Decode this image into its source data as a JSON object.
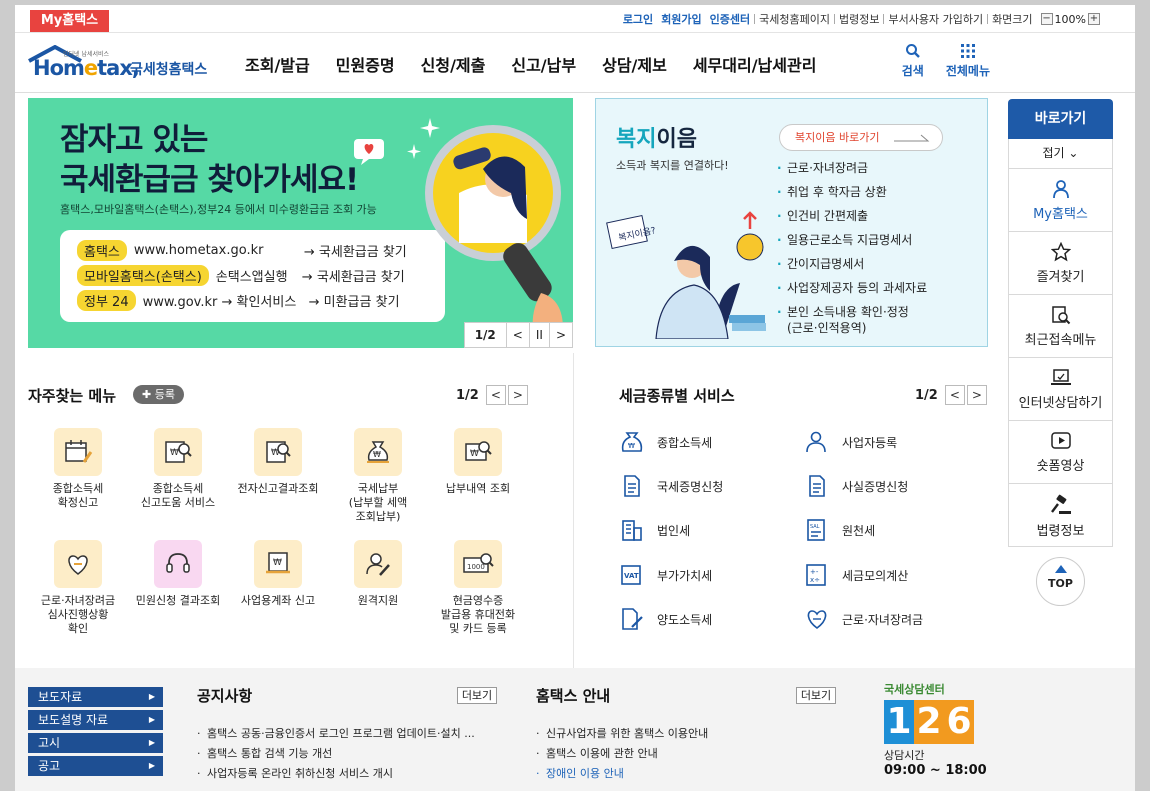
{
  "util": {
    "my_hometax": "My홈택스",
    "login": "로그인",
    "join": "회원가입",
    "cert_center": "인증센터",
    "links": [
      "국세청홈페이지",
      "법령정보",
      "부서사용자 가입하기",
      "화면크기"
    ],
    "zoom_minus": "−",
    "zoom_level": "100%",
    "zoom_plus": "+"
  },
  "logo": {
    "sub": "인터넷 납세서비스",
    "main_a": "Hom",
    "main_e": "e",
    "main_b": "tax,",
    "nts": "국세청홈택스"
  },
  "gnb": [
    "조회/발급",
    "민원증명",
    "신청/제출",
    "신고/납부",
    "상담/제보",
    "세무대리/납세관리"
  ],
  "header_icons": {
    "search": "검색",
    "all_menu": "전체메뉴"
  },
  "banner": {
    "title_line1": "잠자고 있는",
    "title_line2": "국세환급금 찾아가세요!",
    "desc": "홈택스,모바일홈택스(손택스),정부24 등에서 미수령환급금 조회 가능",
    "rows": [
      {
        "pill": "홈택스",
        "site": "www.hometax.go.kr",
        "action": "→ 국세환급금 찾기"
      },
      {
        "pill": "모바일홈택스(손택스)",
        "site": "손택스앱실행",
        "action": "→ 국세환급금 찾기"
      },
      {
        "pill": "정부 24",
        "site": "www.gov.kr → 확인서비스",
        "action": "→ 미환급금 찾기"
      }
    ],
    "page": "1/2",
    "prev": "<",
    "pause": "II",
    "next": ">"
  },
  "welfare": {
    "title_a": "복지",
    "title_b": "이음",
    "subtitle": "소득과 복지를 연결하다!",
    "link": "복지이음 바로가기",
    "sign": "복지이음?",
    "items": [
      "근로·자녀장려금",
      "취업 후 학자금 상환",
      "인건비 간편제출",
      "일용근로소득 지급명세서",
      "간이지급명세서",
      "사업장제공자 등의 과세자료",
      "본인 소득내용 확인·정정 (근로·인적용역)"
    ]
  },
  "quick": {
    "title": "바로가기",
    "fold": "접기 ⌄",
    "items": [
      "My홈택스",
      "즐겨찾기",
      "최근접속메뉴",
      "인터넷상담하기",
      "숏폼영상",
      "법령정보"
    ],
    "top": "TOP"
  },
  "favorites": {
    "title": "자주찾는 메뉴",
    "register": "✚ 등록",
    "page": "1/2",
    "items": [
      "종합소득세\n확정신고",
      "종합소득세\n신고도움 서비스",
      "전자신고결과조회",
      "국세납부\n(납부할 세액\n조회납부)",
      "납부내역 조회",
      "근로·자녀장려금\n심사진행상황\n확인",
      "민원신청 결과조회",
      "사업용계좌 신고",
      "원격지원",
      "현금영수증\n발급용 휴대전화\n및 카드 등록"
    ]
  },
  "tax_services": {
    "title": "세금종류별 서비스",
    "page": "1/2",
    "left": [
      "종합소득세",
      "국세증명신청",
      "법인세",
      "부가가치세",
      "양도소득세"
    ],
    "right": [
      "사업자등록",
      "사실증명신청",
      "원천세",
      "세금모의계산",
      "근로·자녀장려금"
    ]
  },
  "bottom": {
    "side": [
      "보도자료",
      "보도설명 자료",
      "고시",
      "공고"
    ],
    "notice": {
      "title": "공지사항",
      "more": "더보기",
      "items": [
        "홈택스 공동·금융인증서 로그인 프로그램 업데이트·설치 ...",
        "홈택스 통합 검색 기능 개선",
        "사업자등록 온라인 취하신청 서비스 개시"
      ]
    },
    "guide": {
      "title": "홈택스 안내",
      "more": "더보기",
      "items": [
        "신규사업자를 위한 홈택스 이용안내",
        "홈택스 이용에 관한 안내",
        "장애인 이용 안내"
      ]
    },
    "center": {
      "label": "국세상담센터",
      "d1": "1",
      "d2": "2",
      "d3": "6",
      "hours_label": "상담시간",
      "hours": "09:00 ~ 18:00"
    }
  },
  "colors": {
    "brand_blue": "#1e5aa8",
    "banner_green": "#56d9a5",
    "accent_red": "#e8433f",
    "welfare_teal": "#15a6bd"
  }
}
